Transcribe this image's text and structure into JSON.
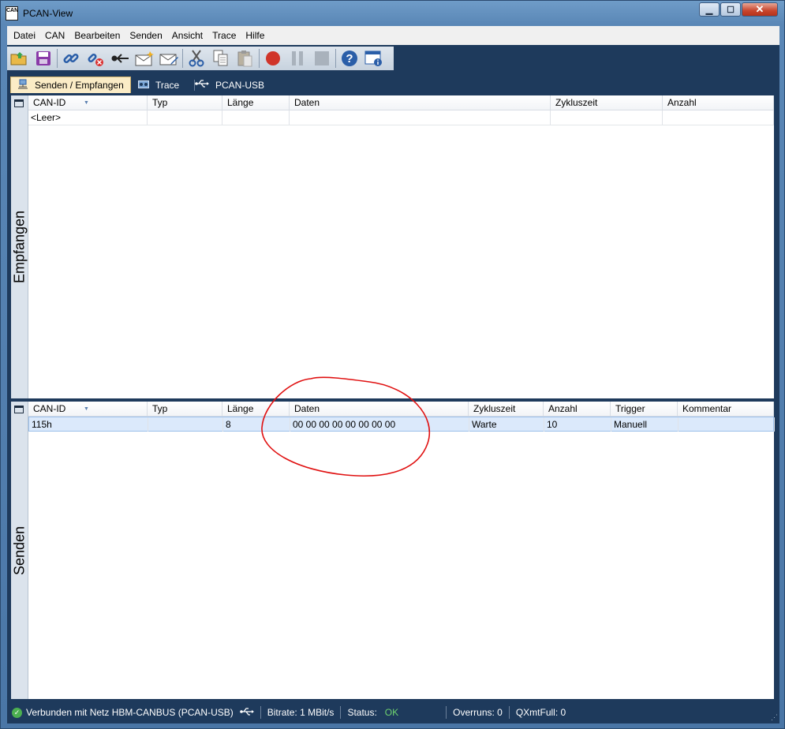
{
  "window": {
    "title": "PCAN-View",
    "app_icon_text": "CAN"
  },
  "menu": [
    "Datei",
    "CAN",
    "Bearbeiten",
    "Senden",
    "Ansicht",
    "Trace",
    "Hilfe"
  ],
  "toolbar": {
    "buttons": [
      "open-icon",
      "save-icon",
      "connect-icon",
      "disconnect-icon",
      "reset-icon",
      "new-message-icon",
      "edit-message-icon",
      "cut-icon",
      "copy-icon",
      "paste-icon",
      "record-icon",
      "pause-icon",
      "stop-icon",
      "help-icon",
      "about-icon"
    ]
  },
  "tabs": [
    {
      "label": "Senden / Empfangen",
      "icon": "network-icon",
      "active": true
    },
    {
      "label": "Trace",
      "icon": "trace-icon",
      "active": false
    },
    {
      "label": "PCAN-USB",
      "icon": "usb-icon",
      "active": false
    }
  ],
  "receive_panel": {
    "side_label": "Empfangen",
    "columns": [
      "CAN-ID",
      "Typ",
      "Länge",
      "Daten",
      "Zykluszeit",
      "Anzahl"
    ],
    "rows": [
      [
        "<Leer>",
        "",
        "",
        "",
        "",
        ""
      ]
    ]
  },
  "send_panel": {
    "side_label": "Senden",
    "columns": [
      "CAN-ID",
      "Typ",
      "Länge",
      "Daten",
      "Zykluszeit",
      "Anzahl",
      "Trigger",
      "Kommentar"
    ],
    "rows": [
      [
        "115h",
        "",
        "8",
        "00 00 00 00 00 00 00 00",
        "Warte",
        "10",
        "Manuell",
        ""
      ]
    ]
  },
  "statusbar": {
    "connection": "Verbunden mit Netz HBM-CANBUS (PCAN-USB)",
    "bitrate": "Bitrate: 1 MBit/s",
    "status_label": "Status:",
    "status_value": "OK",
    "overruns": "Overruns: 0",
    "qxmtfull": "QXmtFull: 0"
  },
  "colors": {
    "frame": "#1e3a5c",
    "active_tab": "#fbecc6",
    "selected_row": "#dbe9fb",
    "annotation": "#e01010",
    "status_ok": "#6fd36f"
  }
}
